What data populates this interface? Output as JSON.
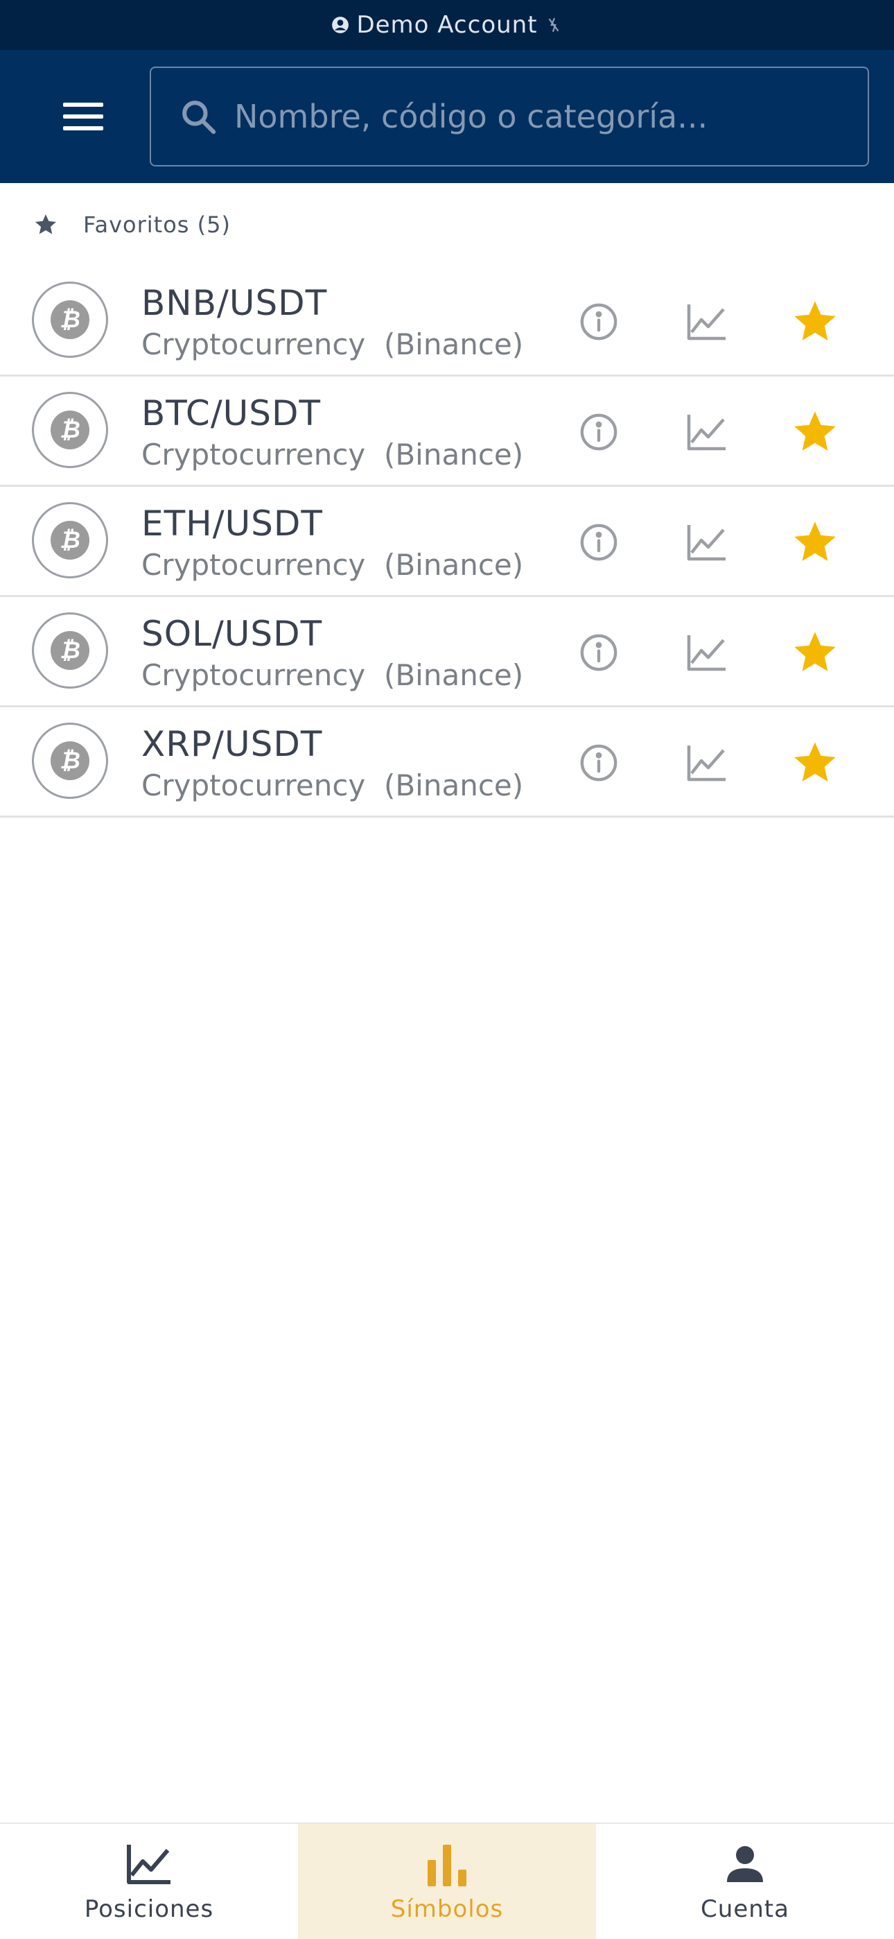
{
  "status_bar": {
    "account_label": "Demo Account"
  },
  "search": {
    "placeholder": "Nombre, código o categoría..."
  },
  "favorites": {
    "title": "Favoritos (5)"
  },
  "symbols": [
    {
      "name": "BNB/USDT",
      "category": "Cryptocurrency",
      "exchange": "(Binance)",
      "favorite": true
    },
    {
      "name": "BTC/USDT",
      "category": "Cryptocurrency",
      "exchange": "(Binance)",
      "favorite": true
    },
    {
      "name": "ETH/USDT",
      "category": "Cryptocurrency",
      "exchange": "(Binance)",
      "favorite": true
    },
    {
      "name": "SOL/USDT",
      "category": "Cryptocurrency",
      "exchange": "(Binance)",
      "favorite": true
    },
    {
      "name": "XRP/USDT",
      "category": "Cryptocurrency",
      "exchange": "(Binance)",
      "favorite": true
    }
  ],
  "bottom_nav": [
    {
      "label": "Posiciones",
      "icon": "line-chart-icon",
      "active": false
    },
    {
      "label": "Símbolos",
      "icon": "bar-chart-icon",
      "active": true
    },
    {
      "label": "Cuenta",
      "icon": "person-icon",
      "active": false
    }
  ],
  "colors": {
    "status_bar_bg": "#022245",
    "header_bg": "#012f5f",
    "favorite_star": "#f5b800",
    "active_nav_bg": "#f8efda",
    "active_nav_text": "#e3a526"
  }
}
